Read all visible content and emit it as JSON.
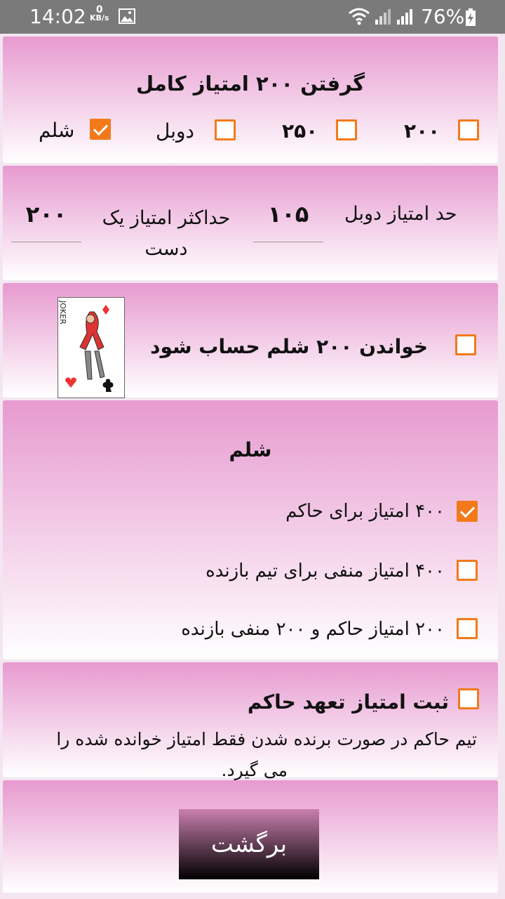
{
  "status_bar": {
    "time": "14:02",
    "net_speed_value": "0",
    "net_speed_unit": "KB/s",
    "battery_percent": "76%"
  },
  "full_points": {
    "title": "گرفتن ۲۰۰ امتیاز کامل",
    "options": [
      {
        "label": "۲۰۰",
        "checked": false
      },
      {
        "label": "۲۵۰",
        "checked": false
      },
      {
        "label": "دوبل",
        "checked": false
      },
      {
        "label": "شلم",
        "checked": true
      }
    ]
  },
  "limits": {
    "double_limit_label": "حد امتیاز دوبل",
    "double_limit_value": "۱۰۵",
    "max_hand_label_line1": "حداکثر امتیاز یک",
    "max_hand_label_line2": "دست",
    "max_hand_value": "۲۰۰"
  },
  "call_200": {
    "label": "خواندن  ۲۰۰ شلم حساب شود",
    "checked": false,
    "card_text": "JOKER"
  },
  "slam": {
    "title": "شلم",
    "options": [
      {
        "label": "۴۰۰ امتیاز برای حاکم",
        "checked": true
      },
      {
        "label": "۴۰۰ امتیاز منفی برای تیم بازنده",
        "checked": false
      },
      {
        "label": "۲۰۰ امتیاز حاکم و ۲۰۰ منفی بازنده",
        "checked": false
      }
    ]
  },
  "commitment": {
    "label": "ثبت امتیاز تعهد حاکم",
    "checked": false,
    "description_line1": "تیم حاکم در صورت برنده شدن فقط امتیاز خوانده شده را",
    "description_line2": "می گیرد."
  },
  "back_button": {
    "label": "برگشت"
  },
  "colors": {
    "accent": "#f27a1a",
    "panel_top": "#e79ad0",
    "status_bar": "#7a7a7a"
  }
}
